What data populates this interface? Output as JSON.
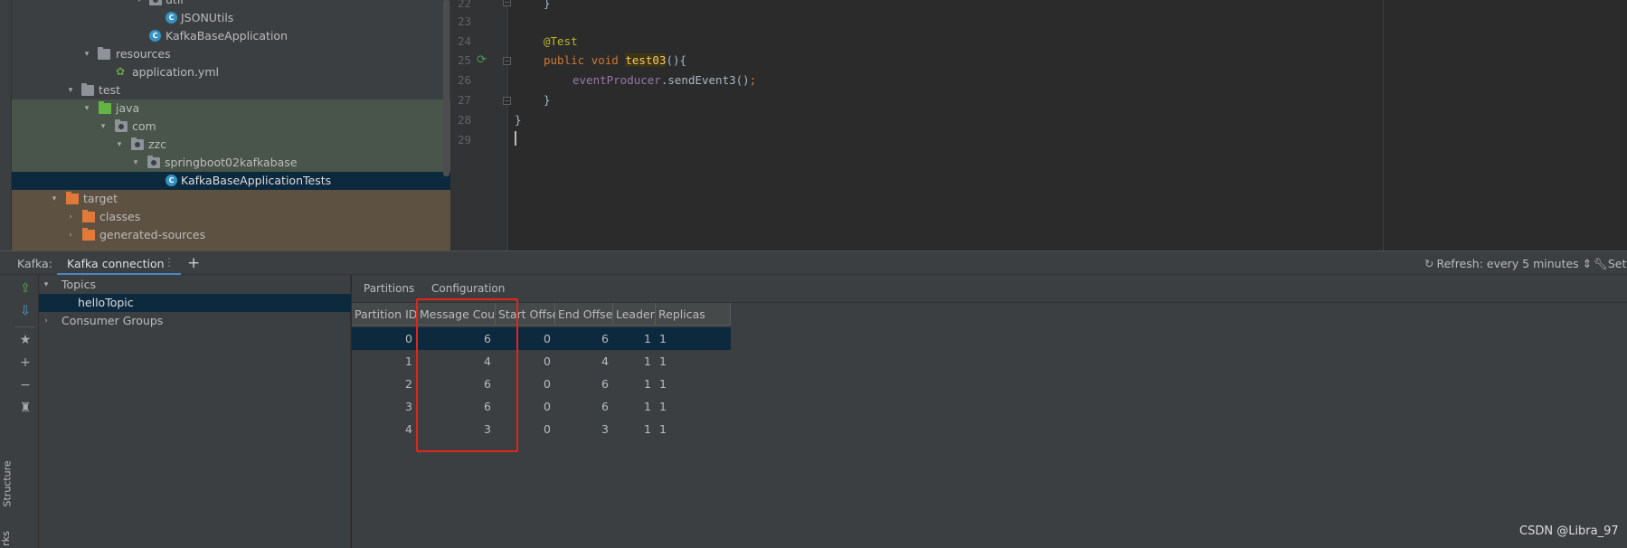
{
  "project_tree": [
    {
      "label": "util",
      "icon": "folder-package-icon",
      "indent": 3,
      "expanded": true
    },
    {
      "label": "JSONUtils",
      "icon": "java-class-icon",
      "indent": 5
    },
    {
      "label": "KafkaBaseApplication",
      "icon": "spring-boot-class-icon",
      "indent": 4
    },
    {
      "label": "resources",
      "icon": "resources-folder-icon",
      "indent": 2,
      "expanded": true
    },
    {
      "label": "application.yml",
      "icon": "yml-file-icon",
      "indent": 3
    },
    {
      "label": "test",
      "icon": "folder-icon",
      "indent": 1,
      "expanded": true
    },
    {
      "label": "java",
      "icon": "test-source-folder-icon",
      "indent": 2,
      "expanded": true
    },
    {
      "label": "com",
      "icon": "package-icon",
      "indent": 3,
      "expanded": true
    },
    {
      "label": "zzc",
      "icon": "package-icon",
      "indent": 4,
      "expanded": true
    },
    {
      "label": "springboot02kafkabase",
      "icon": "package-icon",
      "indent": 5,
      "expanded": true
    },
    {
      "label": "KafkaBaseApplicationTests",
      "icon": "java-class-icon",
      "indent": 6
    },
    {
      "label": "target",
      "icon": "excluded-folder-icon",
      "indent": 1,
      "expanded": true
    },
    {
      "label": "classes",
      "icon": "excluded-folder-icon",
      "indent": 2,
      "expanded": false
    },
    {
      "label": "generated-sources",
      "icon": "excluded-folder-icon",
      "indent": 2,
      "expanded": false
    }
  ],
  "editor": {
    "line_numbers": [
      "22",
      "23",
      "24",
      "25",
      "26",
      "27",
      "28",
      "29"
    ],
    "lines": {
      "l22": "}",
      "l24_annotation": "@Test",
      "l25_kw1": "public",
      "l25_kw2": "void",
      "l25_method": "test03",
      "l25_rest": "(){",
      "l26_field": "eventProducer",
      "l26_call": ".sendEvent3()",
      "l26_semi": ";",
      "l27": "}",
      "l28": "}"
    }
  },
  "kafka_bar": {
    "label": "Kafka:",
    "tab": "Kafka connection",
    "tab_menu": "⋮",
    "add": "+",
    "refresh": "Refresh: every 5 minutes",
    "refresh_arrows": "⇕",
    "settings": "Sett"
  },
  "topics_tree": {
    "topics_label": "Topics",
    "topic": "helloTopic",
    "consumer_groups_label": "Consumer Groups"
  },
  "partition_tabs": [
    "Partitions",
    "Configuration"
  ],
  "partition_table": {
    "columns": [
      "Partition ID",
      "Message Count",
      "Start Offset",
      "End Offset",
      "Leader",
      "Replicas"
    ],
    "rows": [
      [
        "0",
        "6",
        "0",
        "6",
        "1",
        "1"
      ],
      [
        "1",
        "4",
        "0",
        "4",
        "1",
        "1"
      ],
      [
        "2",
        "6",
        "0",
        "6",
        "1",
        "1"
      ],
      [
        "3",
        "6",
        "0",
        "6",
        "1",
        "1"
      ],
      [
        "4",
        "3",
        "0",
        "3",
        "1",
        "1"
      ]
    ]
  },
  "side_tabs": {
    "structure": "Structure",
    "bottom": "rks"
  },
  "watermark": "CSDN @Libra_97",
  "colors": {
    "highlight_box": "#e1251b",
    "selection": "#0d293e",
    "accent": "#4a88c7"
  }
}
